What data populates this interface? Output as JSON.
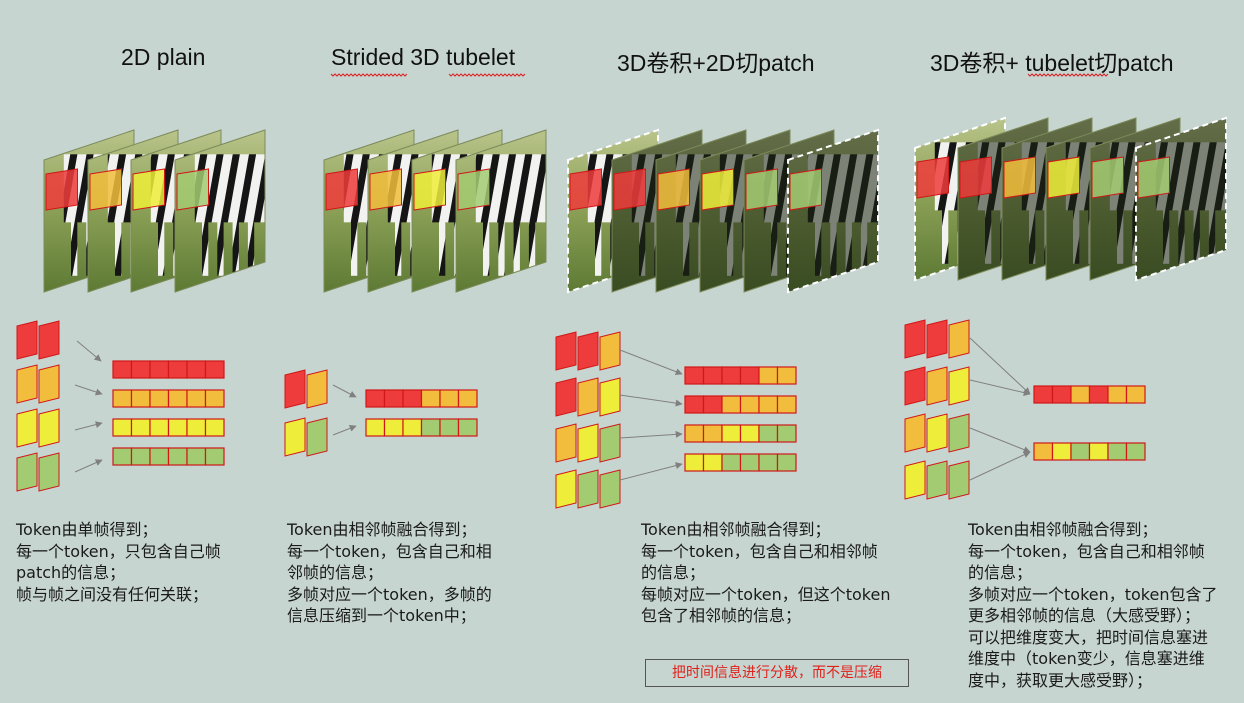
{
  "columns": [
    {
      "id": "2d-plain",
      "title": "2D plain",
      "description": "Token由单帧得到；\n每一个token，只包含自己帧\npatch的信息；\n帧与帧之间没有任何关联；"
    },
    {
      "id": "strided-3d-tubelet",
      "title": "Strided 3D tubelet",
      "description": "Token由相邻帧融合得到；\n每一个token，包含自己和相\n邻帧的信息；\n多帧对应一个token，多帧的\n信息压缩到一个token中；"
    },
    {
      "id": "3d-conv-2d-patch",
      "title": "3D卷积+2D切patch",
      "description": "Token由相邻帧融合得到；\n每一个token，包含自己和相邻帧\n的信息；\n每帧对应一个token，但这个token\n包含了相邻帧的信息；"
    },
    {
      "id": "3d-conv-tubelet-patch",
      "title": "3D卷积+ tubelet切patch",
      "description": "Token由相邻帧融合得到；\n每一个token，包含自己和相邻帧\n的信息；\n多帧对应一个token，token包含了\n更多相邻帧的信息（大感受野）；\n可以把维度变大，把时间信息塞进\n维度中（token变少，信息塞进维\n度中，获取更大感受野）；"
    }
  ],
  "note": "把时间信息进行分散，而不是压缩",
  "colors": {
    "red": "#ee3b3b",
    "orange": "#f2bd3c",
    "yellow": "#eeee3a",
    "green": "#a3cb72",
    "cell_border": "#d01818",
    "arrow": "#808080",
    "frame_dark": "#2e3624",
    "frame_light": "#6e8a46",
    "note_text": "#e0201a"
  },
  "token_rows": {
    "col1": [
      [
        "red",
        "red",
        "red",
        "red",
        "red",
        "red"
      ],
      [
        "orange",
        "orange",
        "orange",
        "orange",
        "orange",
        "orange"
      ],
      [
        "yellow",
        "yellow",
        "yellow",
        "yellow",
        "yellow",
        "yellow"
      ],
      [
        "green",
        "green",
        "green",
        "green",
        "green",
        "green"
      ]
    ],
    "col2": [
      [
        "red",
        "red",
        "red",
        "orange",
        "orange",
        "orange"
      ],
      [
        "yellow",
        "yellow",
        "yellow",
        "green",
        "green",
        "green"
      ]
    ],
    "col3": [
      [
        "red",
        "red",
        "red",
        "red",
        "orange",
        "orange"
      ],
      [
        "red",
        "red",
        "orange",
        "orange",
        "orange",
        "orange"
      ],
      [
        "orange",
        "orange",
        "yellow",
        "yellow",
        "green",
        "green"
      ],
      [
        "yellow",
        "yellow",
        "green",
        "green",
        "green",
        "green"
      ]
    ],
    "col4": [
      [
        "red",
        "red",
        "orange",
        "red",
        "orange",
        "orange"
      ],
      [
        "orange",
        "yellow",
        "green",
        "yellow",
        "green",
        "green"
      ]
    ]
  },
  "frame_groups": {
    "col1": [
      [
        "red",
        "red"
      ],
      [
        "orange",
        "orange"
      ],
      [
        "yellow",
        "yellow"
      ],
      [
        "green",
        "green"
      ]
    ],
    "col2": [
      [
        "red",
        "orange"
      ],
      [
        "yellow",
        "green"
      ]
    ],
    "col3": [
      [
        "red",
        "red",
        "orange"
      ],
      [
        "red",
        "orange",
        "yellow"
      ],
      [
        "orange",
        "yellow",
        "green"
      ],
      [
        "yellow",
        "green",
        "green"
      ]
    ],
    "col4": [
      [
        "red",
        "red",
        "orange"
      ],
      [
        "red",
        "orange",
        "yellow"
      ],
      [
        "orange",
        "yellow",
        "green"
      ],
      [
        "yellow",
        "green",
        "green"
      ]
    ]
  }
}
